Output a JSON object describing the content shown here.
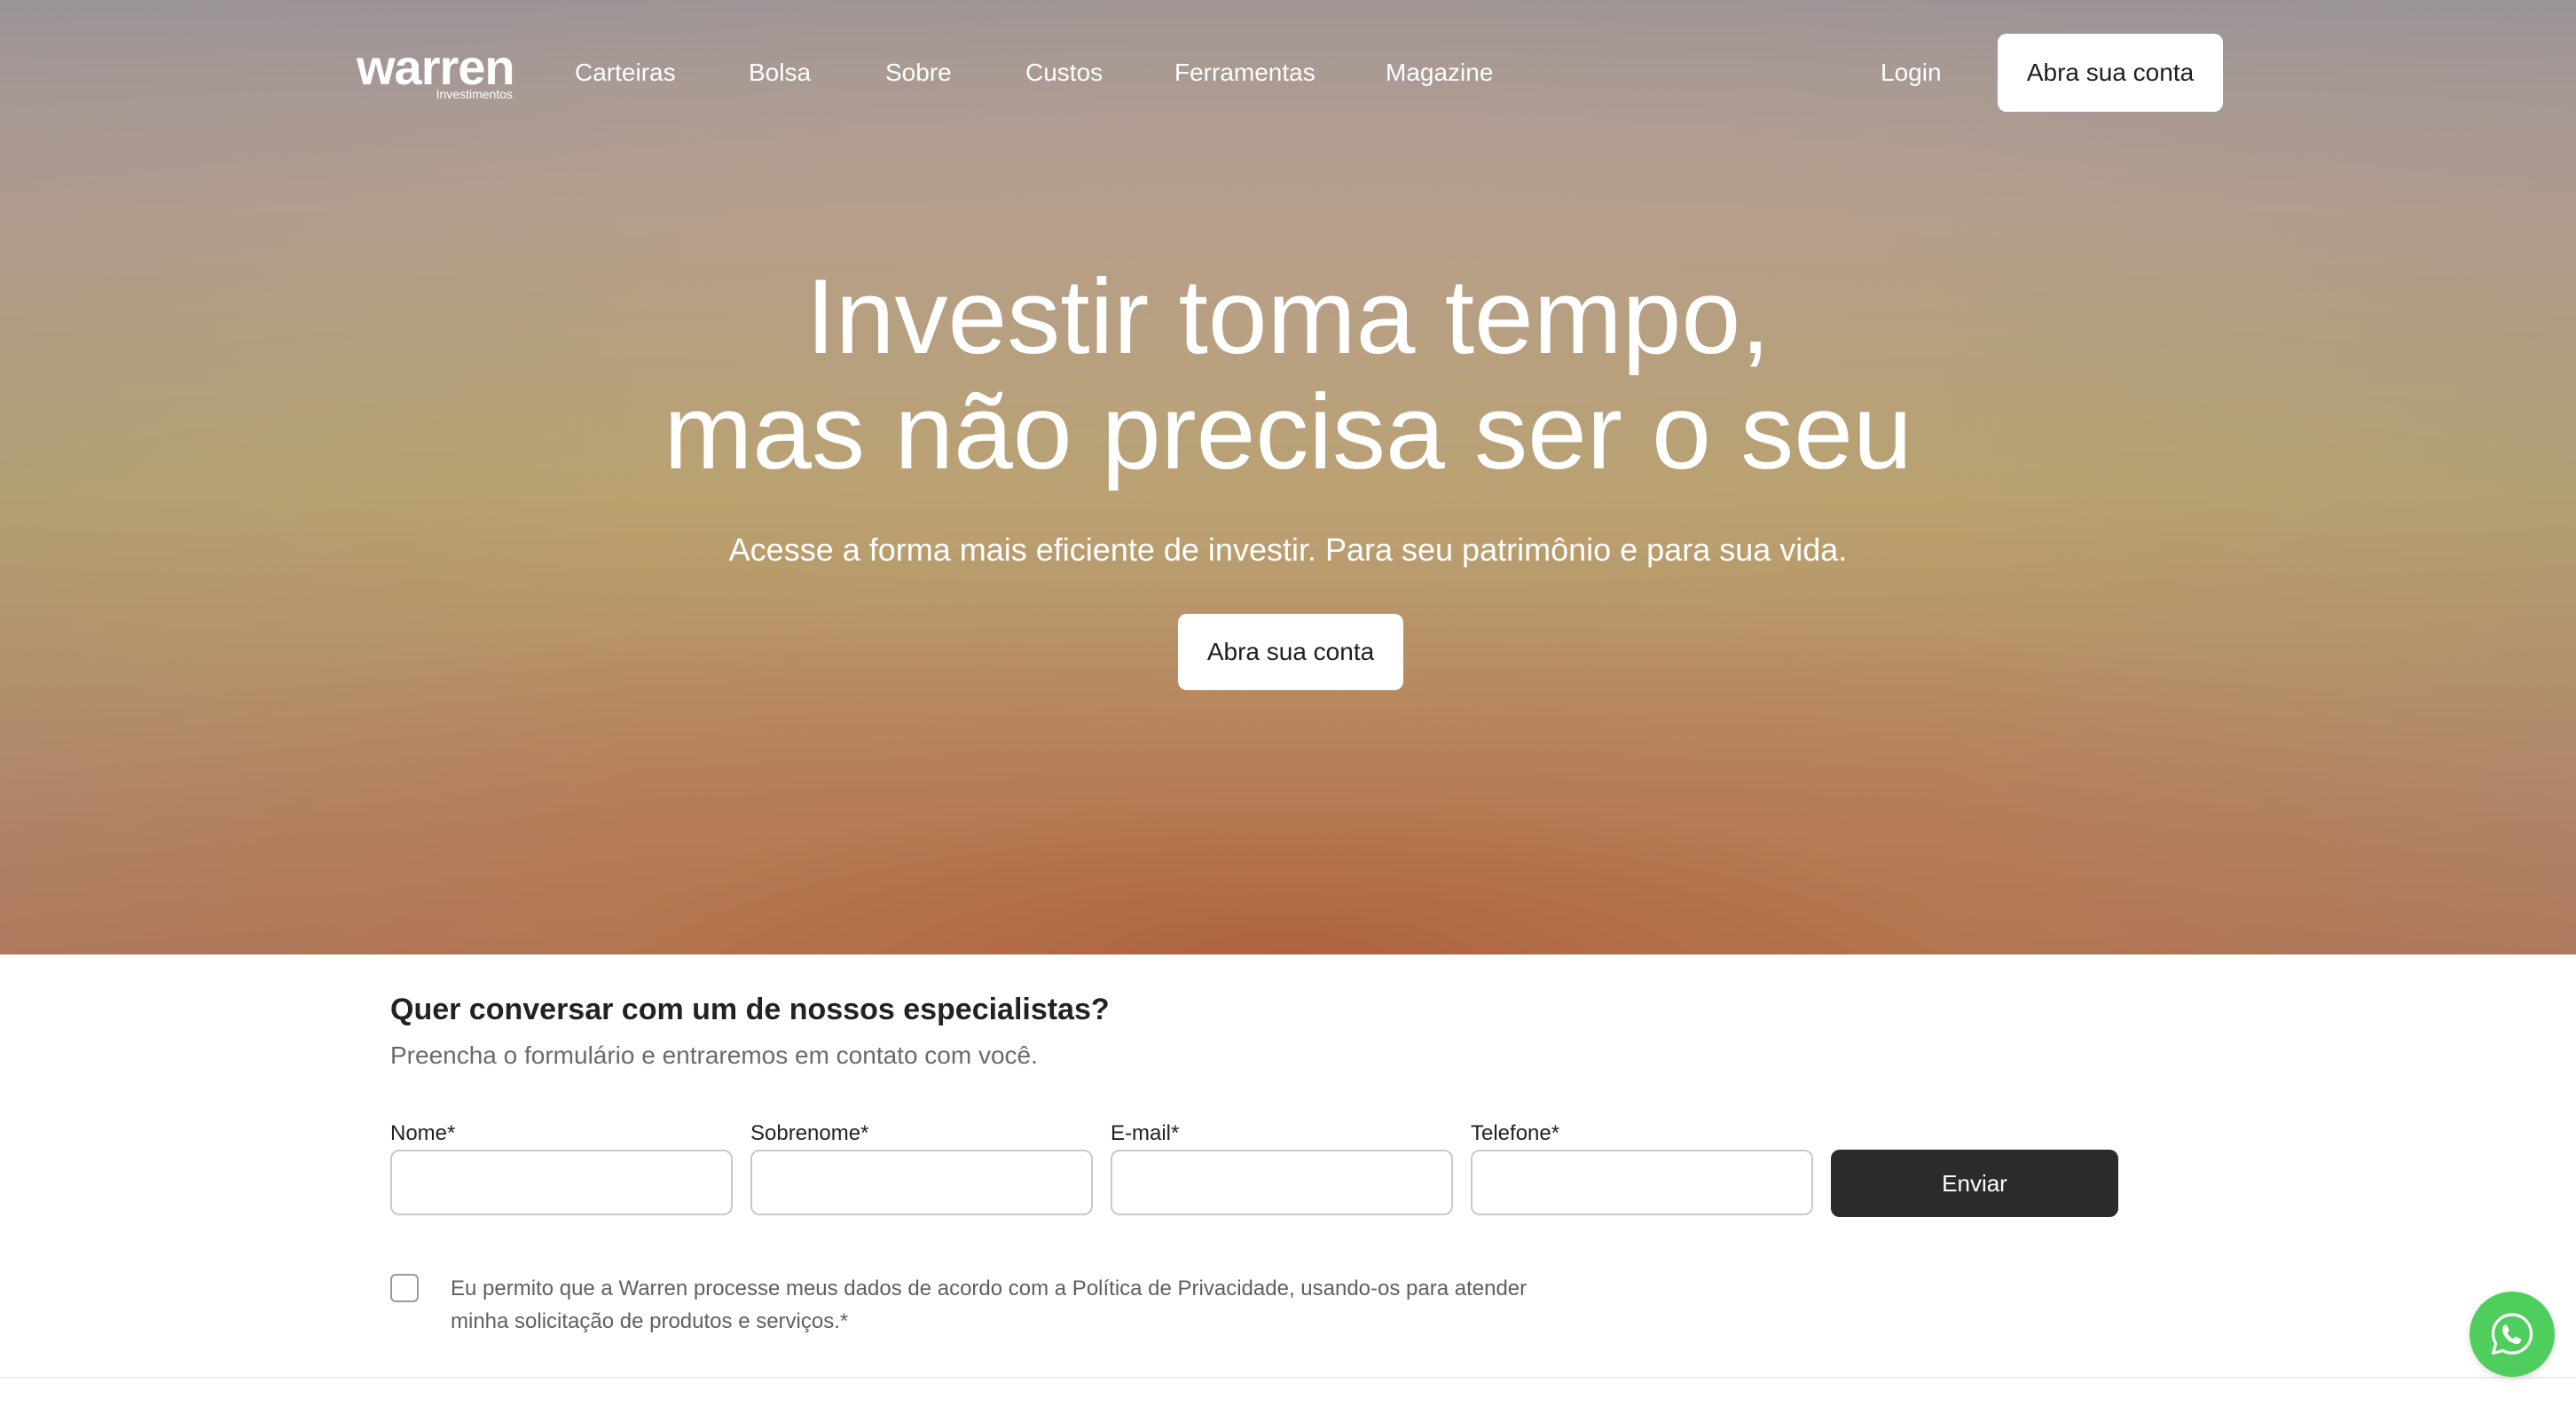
{
  "brand": {
    "name": "warren",
    "subtitle": "Investimentos"
  },
  "nav": {
    "items": [
      {
        "label": "Carteiras"
      },
      {
        "label": "Bolsa"
      },
      {
        "label": "Sobre"
      },
      {
        "label": "Custos"
      },
      {
        "label": "Ferramentas"
      },
      {
        "label": "Magazine"
      }
    ],
    "login_label": "Login",
    "cta_label": "Abra sua conta"
  },
  "hero": {
    "title_line1": "Investir toma tempo,",
    "title_line2": "mas não precisa ser o seu",
    "subtitle": "Acesse a forma mais eficiente de investir. Para seu patrimônio e para sua vida.",
    "cta_label": "Abra sua conta"
  },
  "contact_form": {
    "title": "Quer conversar com um de nossos especialistas?",
    "subtitle": "Preencha o formulário e entraremos em contato com você.",
    "fields": [
      {
        "label": "Nome*",
        "value": ""
      },
      {
        "label": "Sobrenome*",
        "value": ""
      },
      {
        "label": "E-mail*",
        "value": ""
      },
      {
        "label": "Telefone*",
        "value": ""
      }
    ],
    "submit_label": "Enviar",
    "consent_text": "Eu permito que a Warren processe meus dados de acordo com a Política de Privacidade, usando-os para atender minha solicitação de produtos e serviços.*",
    "consent_checked": false
  },
  "floating": {
    "icon": "whatsapp-icon",
    "color": "#4fce5d"
  },
  "colors": {
    "primary_button": "#2b2b2b",
    "hero_button": "#ffffff"
  }
}
